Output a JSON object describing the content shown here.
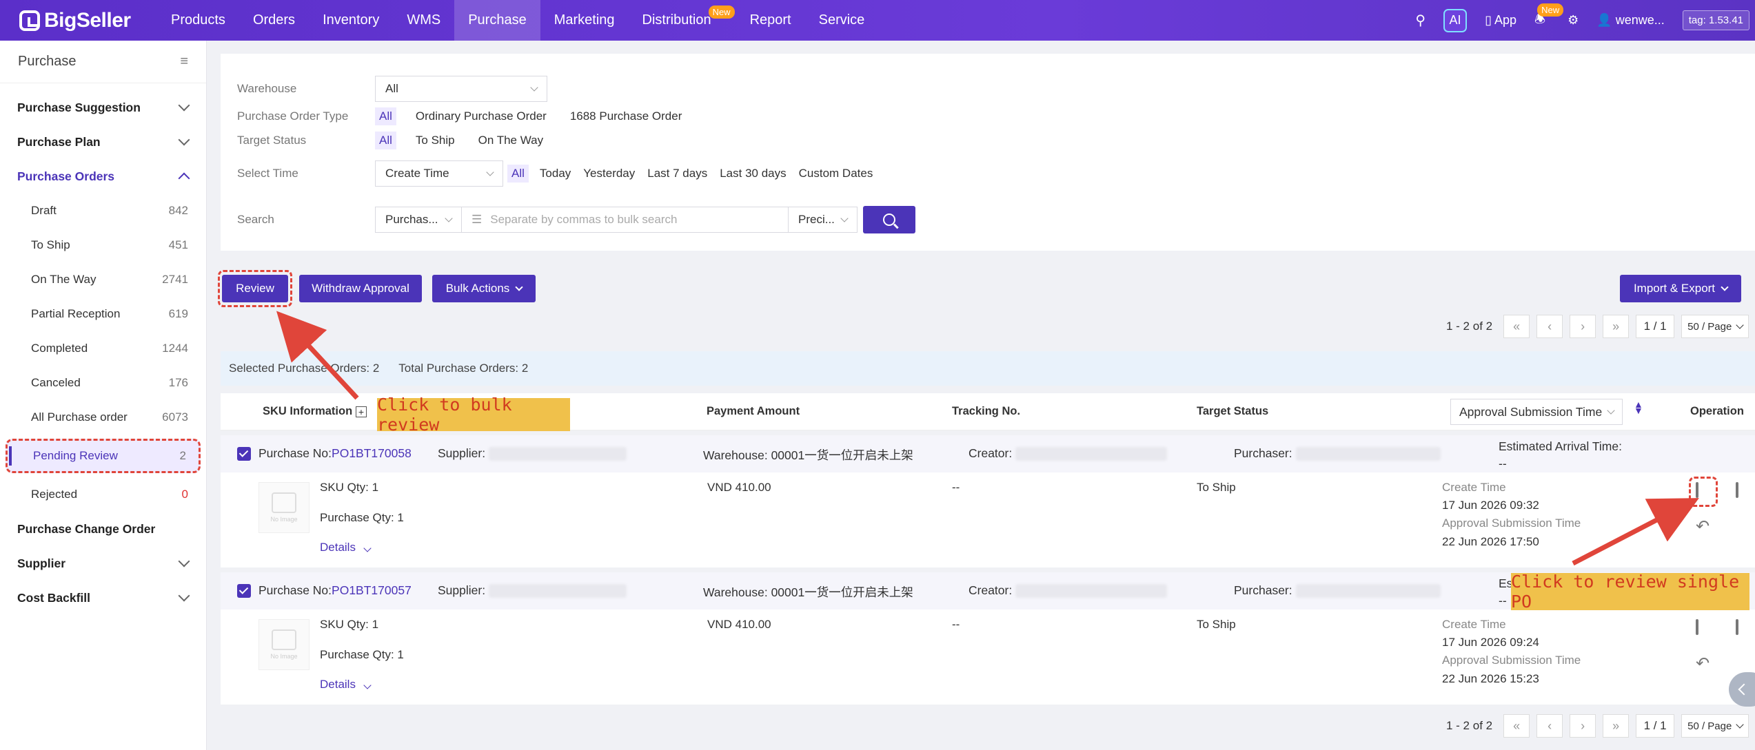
{
  "app": {
    "logo": "BigSeller",
    "tag": "tag: 1.53.41"
  },
  "nav": {
    "items": [
      {
        "label": "Products"
      },
      {
        "label": "Orders"
      },
      {
        "label": "Inventory"
      },
      {
        "label": "WMS"
      },
      {
        "label": "Purchase",
        "active": true
      },
      {
        "label": "Marketing"
      },
      {
        "label": "Distribution",
        "badge": "New"
      },
      {
        "label": "Report"
      },
      {
        "label": "Service"
      }
    ],
    "ai": "AI",
    "app_label": "App",
    "notif_badge": "New",
    "user": "wenwe..."
  },
  "sidebar": {
    "title": "Purchase",
    "groups": [
      {
        "label": "Purchase Suggestion"
      },
      {
        "label": "Purchase Plan"
      },
      {
        "label": "Purchase Orders"
      }
    ],
    "items": [
      {
        "label": "Draft",
        "count": "842"
      },
      {
        "label": "To Ship",
        "count": "451"
      },
      {
        "label": "On The Way",
        "count": "2741"
      },
      {
        "label": "Partial Reception",
        "count": "619"
      },
      {
        "label": "Completed",
        "count": "1244"
      },
      {
        "label": "Canceled",
        "count": "176"
      },
      {
        "label": "All Purchase order",
        "count": "6073"
      },
      {
        "label": "Pending Review",
        "count": "2"
      },
      {
        "label": "Rejected",
        "count": "0"
      }
    ],
    "bottom_groups": [
      {
        "label": "Purchase Change Order"
      },
      {
        "label": "Supplier"
      },
      {
        "label": "Cost Backfill"
      }
    ]
  },
  "filters": {
    "warehouse": {
      "label": "Warehouse",
      "value": "All"
    },
    "order_type": {
      "label": "Purchase Order Type",
      "options": [
        "All",
        "Ordinary Purchase Order",
        "1688 Purchase Order"
      ]
    },
    "target_status": {
      "label": "Target Status",
      "options": [
        "All",
        "To Ship",
        "On The Way"
      ]
    },
    "select_time": {
      "label": "Select Time",
      "field": "Create Time",
      "options": [
        "All",
        "Today",
        "Yesterday",
        "Last 7 days",
        "Last 30 days",
        "Custom Dates"
      ]
    },
    "search": {
      "label": "Search",
      "field": "Purchas...",
      "placeholder": "Separate by commas to bulk search",
      "mode": "Preci..."
    }
  },
  "actions": {
    "review": "Review",
    "withdraw": "Withdraw Approval",
    "bulk": "Bulk Actions",
    "import_export": "Import & Export"
  },
  "pager": {
    "range": "1 - 2 of 2",
    "page": "1 / 1",
    "size": "50 / Page"
  },
  "summary": {
    "selected": "Selected Purchase Orders: 2",
    "total": "Total Purchase Orders: 2"
  },
  "table": {
    "headers": {
      "sku": "SKU Information",
      "payment": "Payment Amount",
      "tracking": "Tracking No.",
      "target": "Target Status",
      "sort": "Approval Submission Time",
      "operation": "Operation"
    }
  },
  "callouts": {
    "bulk": "Click to bulk review",
    "single": "Click to review single PO"
  },
  "orders": [
    {
      "po_label": "Purchase No:",
      "po_no": "PO1BT170058",
      "supplier_label": "Supplier:",
      "warehouse": "Warehouse: 00001一货一位开启未上架",
      "creator_label": "Creator:",
      "purchaser_label": "Purchaser:",
      "eta_label": "Estimated Arrival Time:",
      "eta_value": "--",
      "sku_qty": "SKU Qty: 1",
      "purchase_qty": "Purchase Qty: 1",
      "details": "Details",
      "payment": "VND 410.00",
      "tracking": "--",
      "target_status": "To Ship",
      "create_label": "Create Time",
      "create_time": "17 Jun 2026 09:32",
      "approval_label": "Approval Submission Time",
      "approval_time": "22 Jun 2026 17:50",
      "no_image": "No Image"
    },
    {
      "po_label": "Purchase No:",
      "po_no": "PO1BT170057",
      "supplier_label": "Supplier:",
      "warehouse": "Warehouse: 00001一货一位开启未上架",
      "creator_label": "Creator:",
      "purchaser_label": "Purchaser:",
      "eta_label": "Es",
      "eta_value": "--",
      "sku_qty": "SKU Qty: 1",
      "purchase_qty": "Purchase Qty: 1",
      "details": "Details",
      "payment": "VND 410.00",
      "tracking": "--",
      "target_status": "To Ship",
      "create_label": "Create Time",
      "create_time": "17 Jun 2026 09:24",
      "approval_label": "Approval Submission Time",
      "approval_time": "22 Jun 2026 15:23",
      "no_image": "No Image"
    }
  ],
  "colors": {
    "brand": "#5b2fc9",
    "accent": "#4b34b8",
    "callout_bg": "#f0c14b",
    "callout_text": "#d13a1f",
    "annotation": "#e0453a"
  }
}
